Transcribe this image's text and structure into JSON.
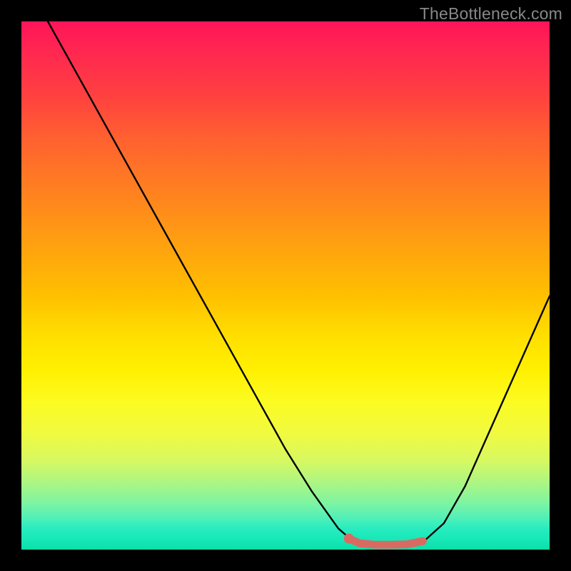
{
  "watermark": "TheBottleneck.com",
  "chart_data": {
    "type": "line",
    "title": "",
    "xlabel": "",
    "ylabel": "",
    "xlim": [
      0,
      100
    ],
    "ylim": [
      0,
      100
    ],
    "series": [
      {
        "name": "bottleneck-curve",
        "color": "#000000",
        "x": [
          5,
          10,
          15,
          20,
          25,
          30,
          35,
          40,
          45,
          50,
          55,
          60,
          63,
          67,
          72,
          76,
          80,
          84,
          88,
          92,
          96,
          100
        ],
        "values": [
          100,
          91,
          82,
          73,
          64,
          55,
          46,
          37,
          28,
          19,
          11,
          4,
          1.4,
          0.7,
          0.7,
          1.4,
          5,
          12,
          21,
          30,
          39,
          48
        ]
      },
      {
        "name": "highlight-segment",
        "color": "#d96a62",
        "x": [
          62,
          64,
          67,
          70,
          73,
          76
        ],
        "values": [
          2.1,
          1.2,
          0.9,
          0.9,
          1.0,
          1.6
        ]
      }
    ],
    "marker": {
      "x": 62,
      "y": 2.1,
      "color": "#d96a62"
    },
    "gradient_stops": [
      {
        "pos": 0,
        "color": "#ff1458"
      },
      {
        "pos": 50,
        "color": "#ffc800"
      },
      {
        "pos": 75,
        "color": "#fff020"
      },
      {
        "pos": 100,
        "color": "#0ae0a8"
      }
    ]
  }
}
